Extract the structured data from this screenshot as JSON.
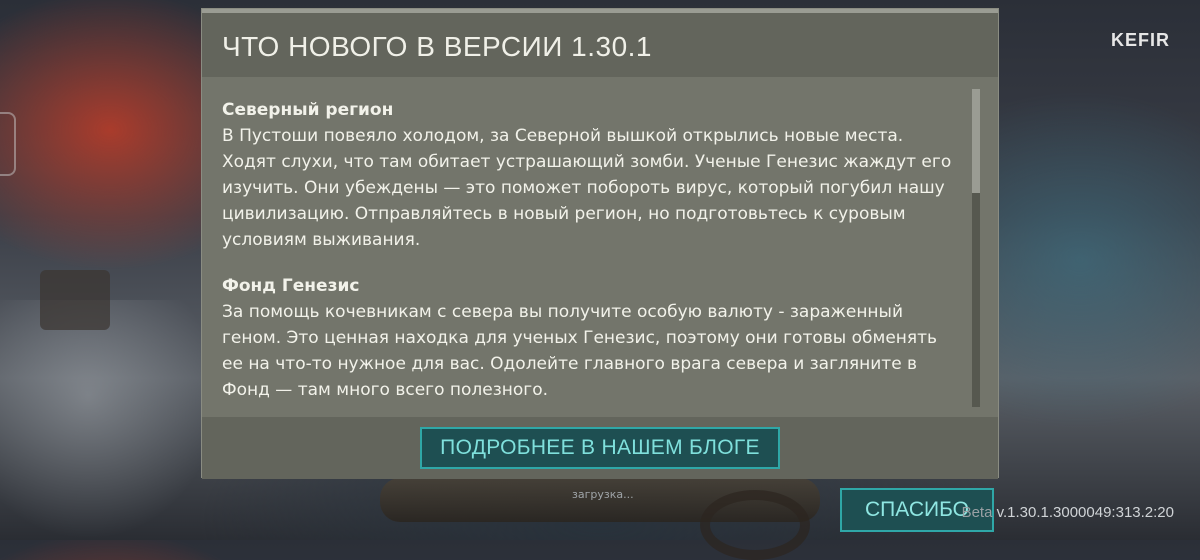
{
  "brand": {
    "logo": "KEFIR"
  },
  "dialog": {
    "title": "ЧТО НОВОГО В ВЕРСИИ 1.30.1",
    "sections": [
      {
        "title": "Северный регион",
        "text": "В Пустоши повеяло холодом, за Северной вышкой открылись новые места. Ходят слухи, что там обитает устрашающий зомби. Ученые Генезис жаждут его изучить. Они убеждены — это поможет побороть вирус, который погубил нашу цивилизацию. Отправляйтесь в новый регион, но подготовьтесь к суровым условиям выживания."
      },
      {
        "title": "Фонд Генезис",
        "text": "За помощь кочевникам с севера вы получите особую валюту - зараженный геном. Это ценная находка для ученых Генезис, поэтому они готовы обменять ее на что-то нужное для вас. Одолейте главного врага севера и загляните в Фонд — там много всего полезного."
      }
    ],
    "blog_button": "ПОДРОБНЕЕ В НАШЕМ БЛОГЕ"
  },
  "loading_text": "загрузка...",
  "thanks_button": "СПАСИБО",
  "version": {
    "prefix": "Beta",
    "value": "v.1.30.1.3000049:313.2:20"
  },
  "colors": {
    "accent": "#2fa7a7",
    "button_bg": "#1e4f52",
    "panel": "#73756b"
  }
}
